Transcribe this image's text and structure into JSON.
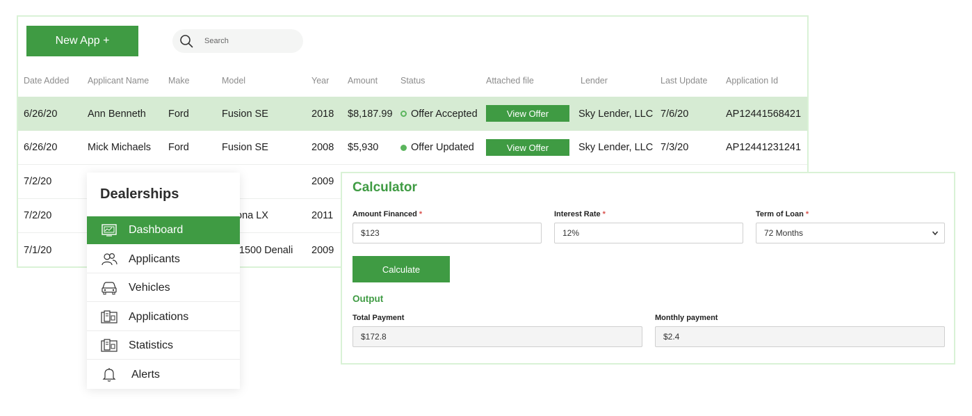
{
  "toolbar": {
    "new_app_label": "New App +",
    "search_placeholder": "Search"
  },
  "table": {
    "columns": [
      "Date Added",
      "Applicant Name",
      "Make",
      "Model",
      "Year",
      "Amount",
      "Status",
      "Attached file",
      "Lender",
      "Last Update",
      "Application Id"
    ],
    "rows": [
      {
        "date": "6/26/20",
        "name": "Ann Benneth",
        "make": "Ford",
        "model": "Fusion SE",
        "year": "2018",
        "amount": "$8,187.99",
        "status": "Offer Accepted",
        "status_style": "hollow",
        "file": "View Offer",
        "lender": "Sky Lender, LLC",
        "update": "7/6/20",
        "app_id": "AP12441568421",
        "selected": true
      },
      {
        "date": "6/26/20",
        "name": "Mick Michaels",
        "make": "Ford",
        "model": "Fusion SE",
        "year": "2008",
        "amount": "$5,930",
        "status": "Offer Updated",
        "status_style": "filled",
        "file": "View Offer",
        "lender": "Sky Lender, LLC",
        "update": "7/3/20",
        "app_id": "AP12441231241",
        "selected": false
      },
      {
        "date": "7/2/20",
        "model": "",
        "year": "2009"
      },
      {
        "date": "7/2/20",
        "model": "ona LX",
        "year": "2011"
      },
      {
        "date": "7/1/20",
        "model": "ra 1500 Denali",
        "year": "2009"
      }
    ]
  },
  "menu": {
    "title": "Dealerships",
    "items": [
      {
        "label": "Dashboard",
        "icon": "dashboard-icon",
        "active": true
      },
      {
        "label": "Applicants",
        "icon": "users-icon",
        "active": false
      },
      {
        "label": "Vehicles",
        "icon": "car-icon",
        "active": false
      },
      {
        "label": "Applications",
        "icon": "document-icon",
        "active": false
      },
      {
        "label": "Statistics",
        "icon": "statistics-icon",
        "active": false
      },
      {
        "label": "Alerts",
        "icon": "bell-icon",
        "active": false
      }
    ]
  },
  "calculator": {
    "title": "Calculator",
    "amount_label": "Amount Financed",
    "amount_value": "$123",
    "rate_label": "Interest Rate",
    "rate_value": "12%",
    "term_label": "Term of Loan",
    "term_value": "72 Months",
    "required_mark": "*",
    "button_label": "Calculate",
    "output_title": "Output",
    "total_label": "Total Payment",
    "total_value": "$172.8",
    "monthly_label": "Monthly payment",
    "monthly_value": "$2.4"
  },
  "colors": {
    "accent": "#3f9b43",
    "selected_row": "#d6ebd3",
    "panel_border": "#d9f2d6",
    "required": "#d9534f"
  }
}
